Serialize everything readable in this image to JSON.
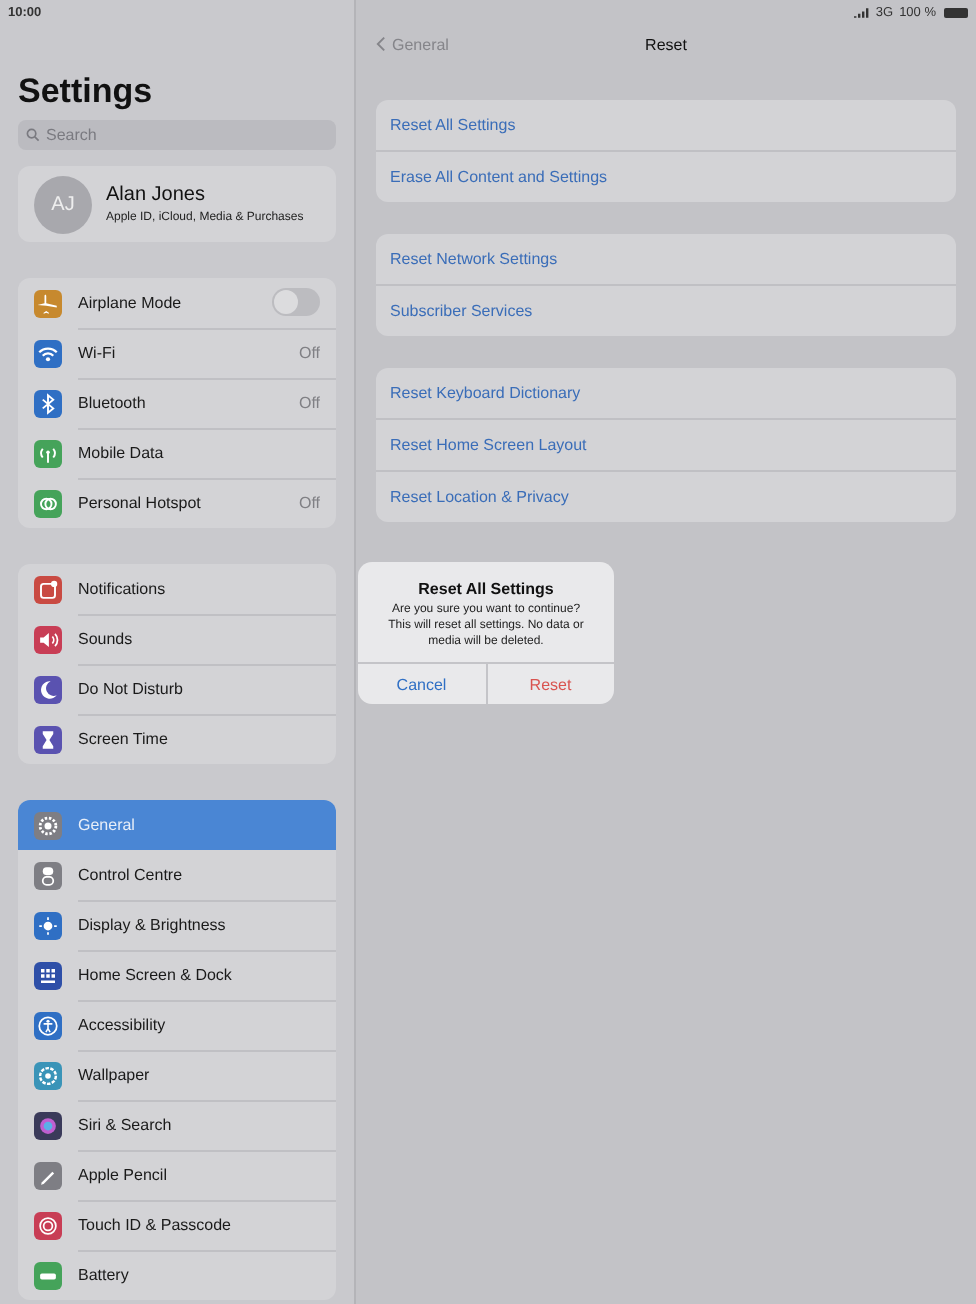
{
  "status_bar": {
    "time": "10:00",
    "network": "3G",
    "battery": "100 %"
  },
  "sidebar": {
    "title": "Settings",
    "search": {
      "placeholder": "Search"
    },
    "profile": {
      "initials": "AJ",
      "name": "Alan Jones",
      "subtitle": "Apple ID, iCloud, Media & Purchases"
    },
    "groups": [
      {
        "items": [
          {
            "label": "Airplane Mode",
            "color": "#c7892e",
            "kind": "toggle",
            "on": false,
            "selected": false
          },
          {
            "label": "Wi-Fi",
            "color": "#2f6fc4",
            "kind": "value",
            "value": "Off",
            "selected": false
          },
          {
            "label": "Bluetooth",
            "color": "#2f6fc4",
            "kind": "value",
            "value": "Off",
            "selected": false
          },
          {
            "label": "Mobile Data",
            "color": "#45a35a",
            "kind": "plain",
            "selected": false
          },
          {
            "label": "Personal Hotspot",
            "color": "#45a35a",
            "kind": "value",
            "value": "Off",
            "selected": false
          }
        ]
      },
      {
        "items": [
          {
            "label": "Notifications",
            "color": "#c94a42",
            "kind": "plain",
            "selected": false
          },
          {
            "label": "Sounds",
            "color": "#c83d55",
            "kind": "plain",
            "selected": false
          },
          {
            "label": "Do Not Disturb",
            "color": "#5a52b0",
            "kind": "plain",
            "selected": false
          },
          {
            "label": "Screen Time",
            "color": "#5a52b0",
            "kind": "plain",
            "selected": false
          }
        ]
      },
      {
        "items": [
          {
            "label": "General",
            "color": "#7e7e84",
            "kind": "plain",
            "selected": true
          },
          {
            "label": "Control Centre",
            "color": "#7e7e84",
            "kind": "plain",
            "selected": false
          },
          {
            "label": "Display & Brightness",
            "color": "#2f6fc4",
            "kind": "plain",
            "selected": false
          },
          {
            "label": "Home Screen & Dock",
            "color": "#2e4fa8",
            "kind": "plain",
            "selected": false
          },
          {
            "label": "Accessibility",
            "color": "#2f6fc4",
            "kind": "plain",
            "selected": false
          },
          {
            "label": "Wallpaper",
            "color": "#3a94b8",
            "kind": "plain",
            "selected": false
          },
          {
            "label": "Siri & Search",
            "color": "#3a3a5a",
            "kind": "plain",
            "selected": false
          },
          {
            "label": "Apple Pencil",
            "color": "#7e7e84",
            "kind": "plain",
            "selected": false
          },
          {
            "label": "Touch ID & Passcode",
            "color": "#c83d55",
            "kind": "plain",
            "selected": false
          },
          {
            "label": "Battery",
            "color": "#45a35a",
            "kind": "plain",
            "selected": false
          }
        ]
      }
    ]
  },
  "detail": {
    "back": "General",
    "title": "Reset",
    "groups": [
      {
        "items": [
          "Reset All Settings",
          "Erase All Content and Settings"
        ]
      },
      {
        "items": [
          "Reset Network Settings",
          "Subscriber Services"
        ]
      },
      {
        "items": [
          "Reset Keyboard Dictionary",
          "Reset Home Screen Layout",
          "Reset Location & Privacy"
        ]
      }
    ]
  },
  "alert": {
    "title": "Reset All Settings",
    "message": "Are you sure you want to continue? This will reset all settings. No data or media will be deleted.",
    "buttons": [
      {
        "label": "Cancel",
        "kind": "cancel"
      },
      {
        "label": "Reset",
        "kind": "destructive"
      }
    ]
  }
}
